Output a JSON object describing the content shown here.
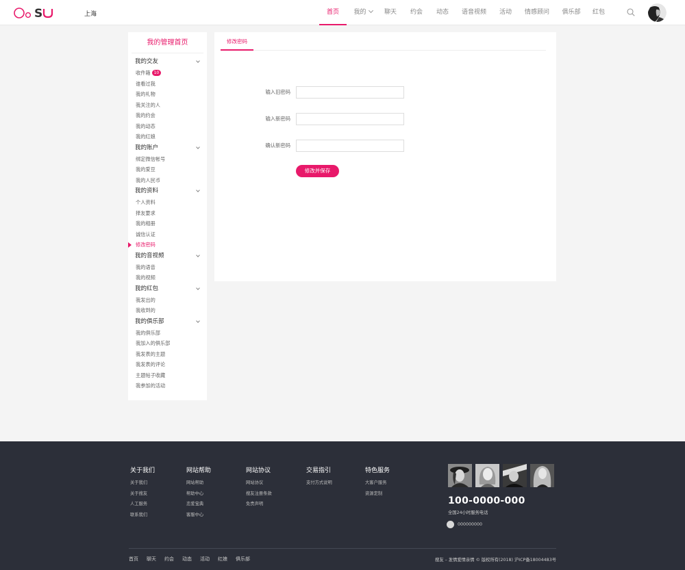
{
  "header": {
    "logo_text": "OoSU",
    "city": "上海",
    "nav": [
      {
        "label": "首页",
        "active": true
      },
      {
        "label": "我的",
        "dropdown": true
      },
      {
        "label": "聊天"
      },
      {
        "label": "约会"
      },
      {
        "label": "动态"
      },
      {
        "label": "语音视频"
      },
      {
        "label": "活动"
      },
      {
        "label": "情感顾问"
      },
      {
        "label": "俱乐部"
      },
      {
        "label": "红包"
      }
    ],
    "search_icon": "search-icon",
    "avatar_icon": "user-avatar"
  },
  "sidebar": {
    "title": "我的管理首页",
    "groups": [
      {
        "title": "我的交友",
        "items": [
          {
            "label": "收件箱",
            "badge": "10"
          },
          {
            "label": "谁看过我"
          },
          {
            "label": "我的礼物"
          },
          {
            "label": "我关注的人"
          },
          {
            "label": "我的约会"
          },
          {
            "label": "我的动态"
          },
          {
            "label": "我的红娘"
          }
        ]
      },
      {
        "title": "我的账户",
        "items": [
          {
            "label": "绑定微信帐号"
          },
          {
            "label": "我的爱豆"
          },
          {
            "label": "我的人民币"
          }
        ]
      },
      {
        "title": "我的资料",
        "items": [
          {
            "label": "个人资料"
          },
          {
            "label": "择友要求"
          },
          {
            "label": "我的相册"
          },
          {
            "label": "诚信认证"
          },
          {
            "label": "修改密码",
            "active": true
          }
        ]
      },
      {
        "title": "我的音视频",
        "items": [
          {
            "label": "我的语音"
          },
          {
            "label": "我的视频"
          }
        ]
      },
      {
        "title": "我的红包",
        "items": [
          {
            "label": "我发出的"
          },
          {
            "label": "我收到的"
          }
        ]
      },
      {
        "title": "我的俱乐部",
        "items": [
          {
            "label": "我的俱乐部"
          },
          {
            "label": "我加入的俱乐部"
          },
          {
            "label": "我发表的主题"
          },
          {
            "label": "我发表的评论"
          },
          {
            "label": "主题帖子收藏"
          },
          {
            "label": "我参加的活动"
          }
        ]
      }
    ]
  },
  "main": {
    "tab": "修改密码",
    "fields": [
      {
        "label": "输入旧密码",
        "value": "",
        "placeholder": ""
      },
      {
        "label": "输入新密码",
        "value": "",
        "placeholder": ""
      },
      {
        "label": "确认新密码",
        "value": "",
        "placeholder": ""
      }
    ],
    "save_label": "修改并保存"
  },
  "footer": {
    "columns": [
      {
        "title": "关于我们",
        "links": [
          "关于我们",
          "关于搜友",
          "人工服务",
          "联系我们"
        ]
      },
      {
        "title": "网站帮助",
        "links": [
          "网站帮助",
          "帮助中心",
          "恋爱宝典",
          "客服中心"
        ]
      },
      {
        "title": "网站协议",
        "links": [
          "网站协议",
          "搜友注册条款",
          "免责声明"
        ]
      },
      {
        "title": "交易指引",
        "links": [
          "支付方式说明"
        ]
      },
      {
        "title": "特色服务",
        "links": [
          "大客户服务",
          "资源定制"
        ]
      }
    ],
    "phone": "100-0000-000",
    "phone_note": "全国24小时服务电话",
    "qq": "000000000",
    "bottom_nav": [
      "首页",
      "聊天",
      "约会",
      "动态",
      "活动",
      "红娘",
      "俱乐部"
    ],
    "copyright": "搜友 – 发情爱情亲情 ©  版权所有(2018)  沪ICP备18004483号"
  },
  "colors": {
    "accent": "#e8196a",
    "footer_bg": "#2c2f39"
  }
}
